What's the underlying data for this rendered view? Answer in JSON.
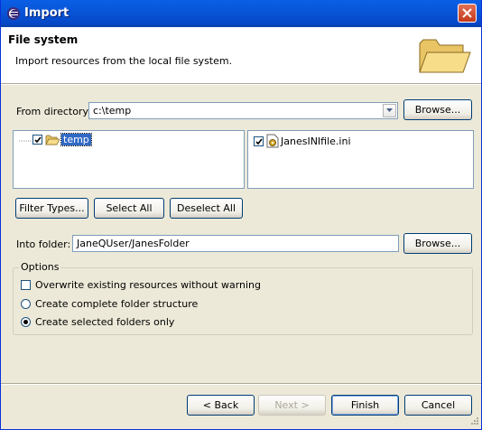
{
  "window": {
    "title": "Import",
    "close_icon": "close-icon"
  },
  "banner": {
    "heading": "File system",
    "description": "Import resources from the local file system.",
    "icon": "folder-icon"
  },
  "from_directory": {
    "label": "From directory:",
    "value": "c:\\temp",
    "browse_label": "Browse..."
  },
  "folder_tree": {
    "items": [
      {
        "label": "temp",
        "checked": true,
        "selected": true
      }
    ]
  },
  "file_list": {
    "items": [
      {
        "label": "JanesINIfile.ini",
        "checked": true
      }
    ]
  },
  "selection_buttons": {
    "filter_types": "Filter Types...",
    "select_all": "Select All",
    "deselect_all": "Deselect All"
  },
  "into_folder": {
    "label": "Into folder:",
    "value": "JaneQUser/JanesFolder",
    "browse_label": "Browse..."
  },
  "options": {
    "legend": "Options",
    "overwrite": {
      "label": "Overwrite existing resources without warning",
      "checked": false
    },
    "create_complete": {
      "label": "Create complete folder structure",
      "selected": false
    },
    "create_selected": {
      "label": "Create selected folders only",
      "selected": true
    }
  },
  "footer": {
    "back": "< Back",
    "next": "Next >",
    "finish": "Finish",
    "cancel": "Cancel"
  }
}
